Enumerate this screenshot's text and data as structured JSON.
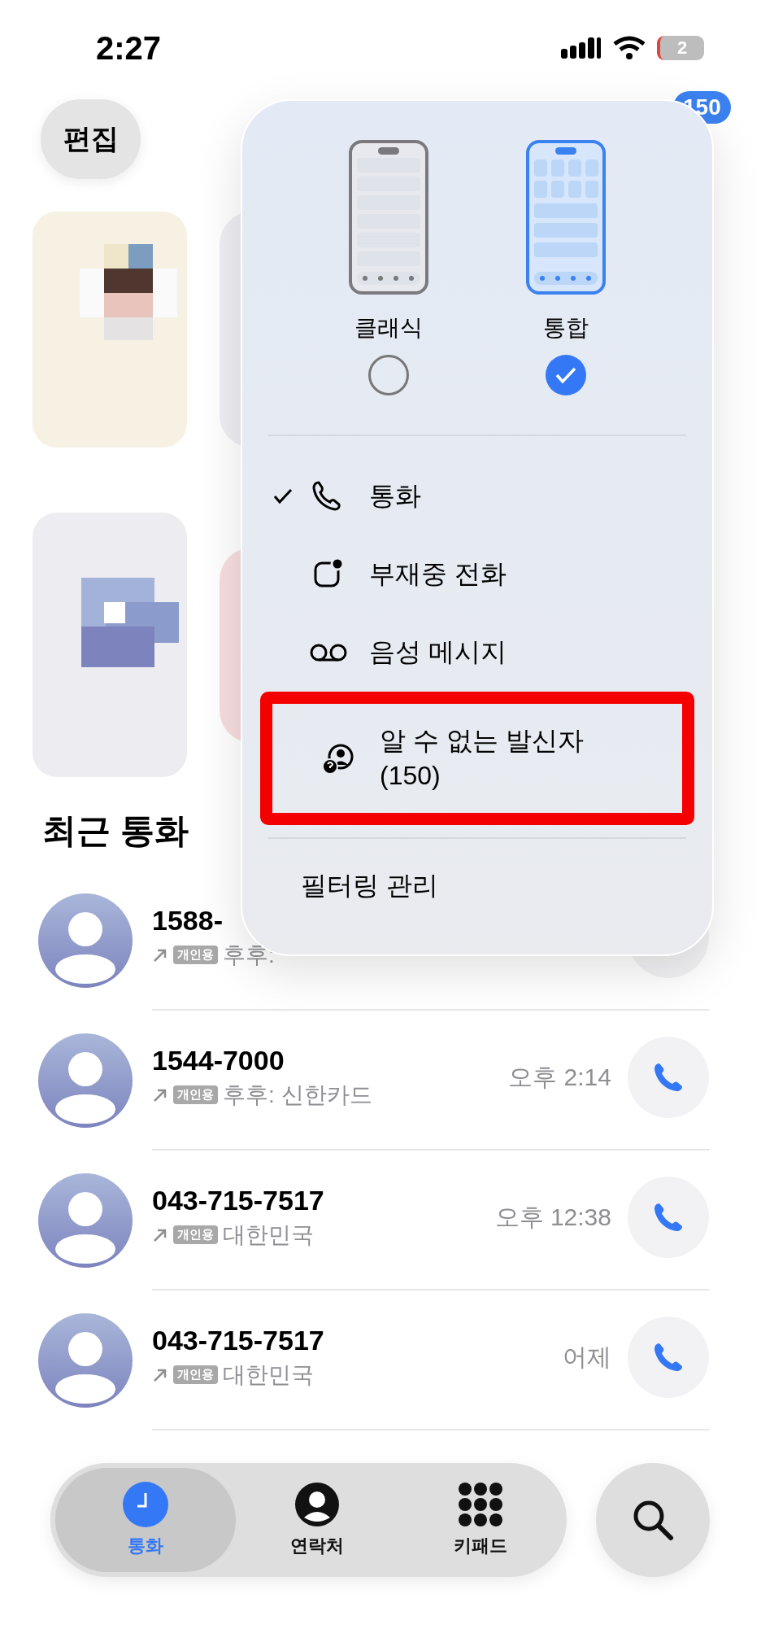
{
  "status_bar": {
    "time": "2:27",
    "battery": "2"
  },
  "edit_button": "편집",
  "badge": "150",
  "section_title": "최근 통화",
  "calls": [
    {
      "number": "1588-",
      "tag": "개인용",
      "detail": "후후:"
    },
    {
      "number": "1544-7000",
      "tag": "개인용",
      "detail": "후후: 신한카드",
      "time": "오후 2:14"
    },
    {
      "number": "043-715-7517",
      "tag": "개인용",
      "detail": "대한민국",
      "time": "오후 12:38"
    },
    {
      "number": "043-715-7517",
      "tag": "개인용",
      "detail": "대한민국",
      "time": "어제"
    }
  ],
  "layout_menu": {
    "options": [
      {
        "label": "클래식",
        "kind": "classic",
        "selected": false
      },
      {
        "label": "통합",
        "kind": "unified",
        "selected": true
      }
    ],
    "items": [
      {
        "label": "통화",
        "kind": "calls",
        "checked": true,
        "highlighted": false
      },
      {
        "label": "부재중 전화",
        "kind": "missed",
        "checked": false,
        "highlighted": false
      },
      {
        "label": "음성 메시지",
        "kind": "voicemail",
        "checked": false,
        "highlighted": false
      },
      {
        "label": "알 수 없는 발신자 (150)",
        "kind": "unknown",
        "checked": false,
        "highlighted": true
      }
    ],
    "footer": "필터링 관리"
  },
  "tabs": [
    {
      "label": "통화",
      "kind": "recents",
      "selected": true
    },
    {
      "label": "연락처",
      "kind": "contacts",
      "selected": false
    },
    {
      "label": "키패드",
      "kind": "keypad",
      "selected": false
    }
  ]
}
